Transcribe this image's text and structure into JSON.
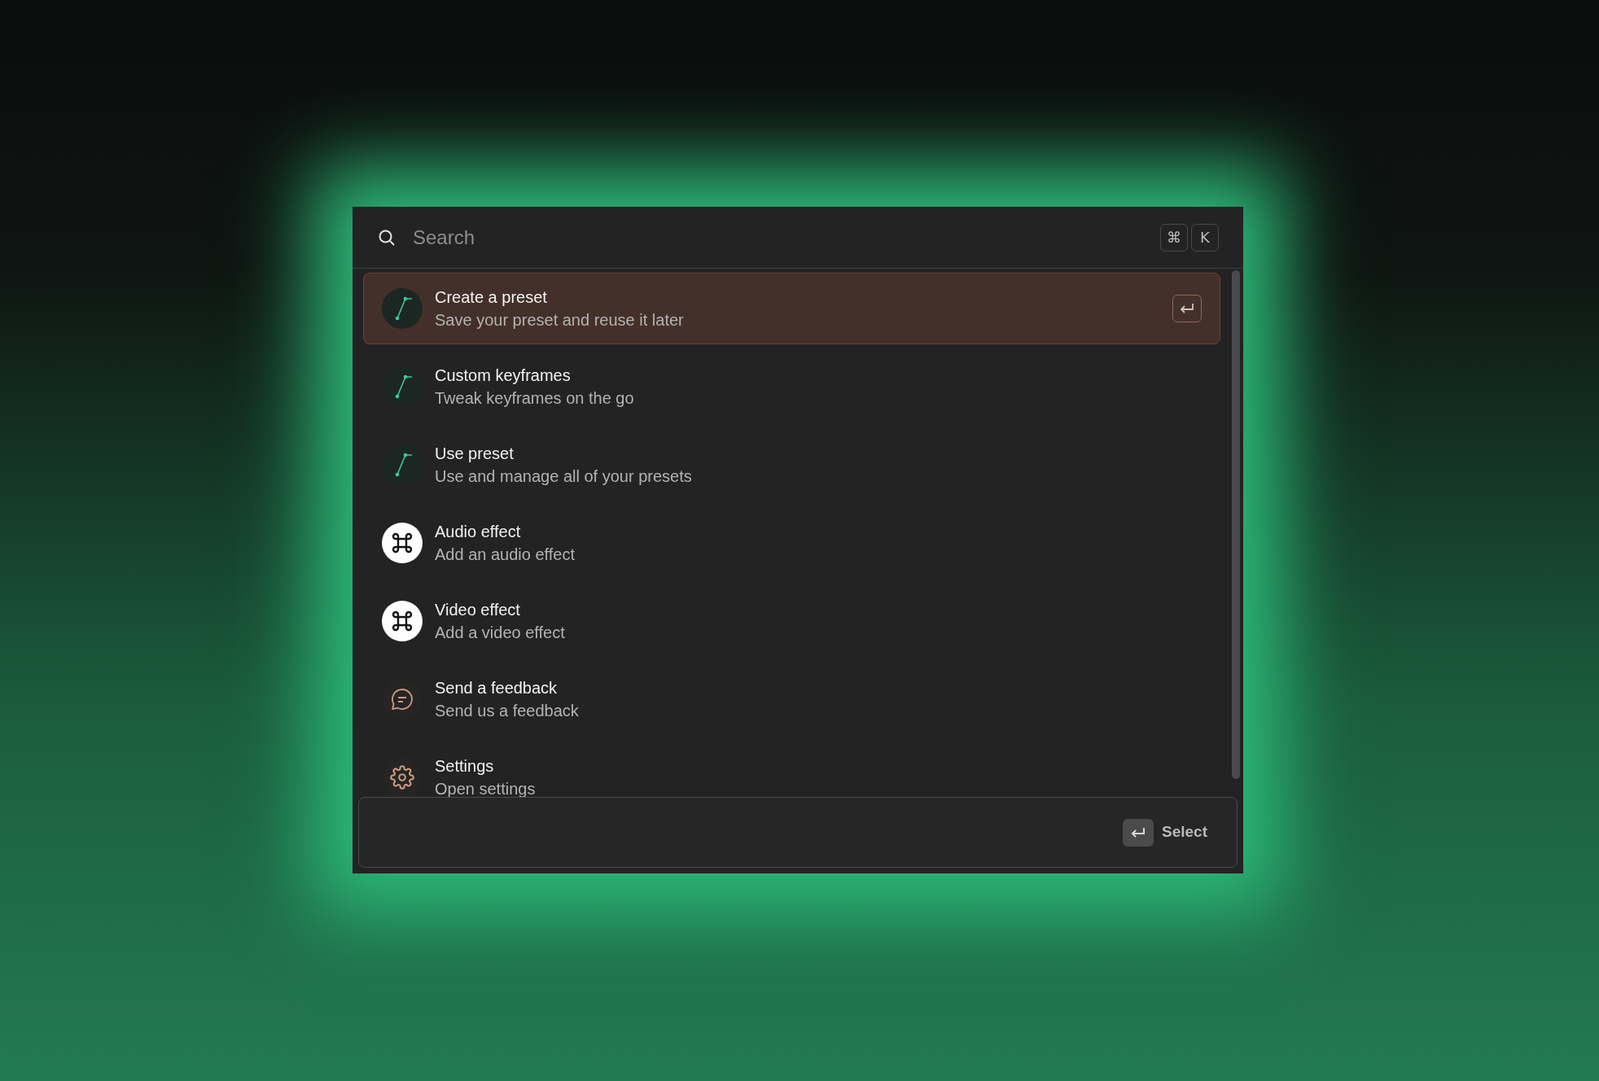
{
  "search": {
    "placeholder": "Search",
    "shortcut": [
      "⌘",
      "K"
    ]
  },
  "items": [
    {
      "kind": "keyframe",
      "title": "Create a preset",
      "subtitle": "Save your preset and reuse it later",
      "selected": true
    },
    {
      "kind": "keyframe",
      "title": "Custom keyframes",
      "subtitle": "Tweak keyframes on the go",
      "selected": false
    },
    {
      "kind": "keyframe",
      "title": "Use preset",
      "subtitle": "Use and manage all of your presets",
      "selected": false
    },
    {
      "kind": "command",
      "title": "Audio effect",
      "subtitle": "Add an audio effect",
      "selected": false
    },
    {
      "kind": "command",
      "title": "Video effect",
      "subtitle": "Add a video effect",
      "selected": false
    },
    {
      "kind": "feedback",
      "title": "Send a feedback",
      "subtitle": "Send us a feedback",
      "selected": false
    },
    {
      "kind": "settings",
      "title": "Settings",
      "subtitle": "Open settings",
      "selected": false
    }
  ],
  "footer": {
    "action": "Select"
  }
}
